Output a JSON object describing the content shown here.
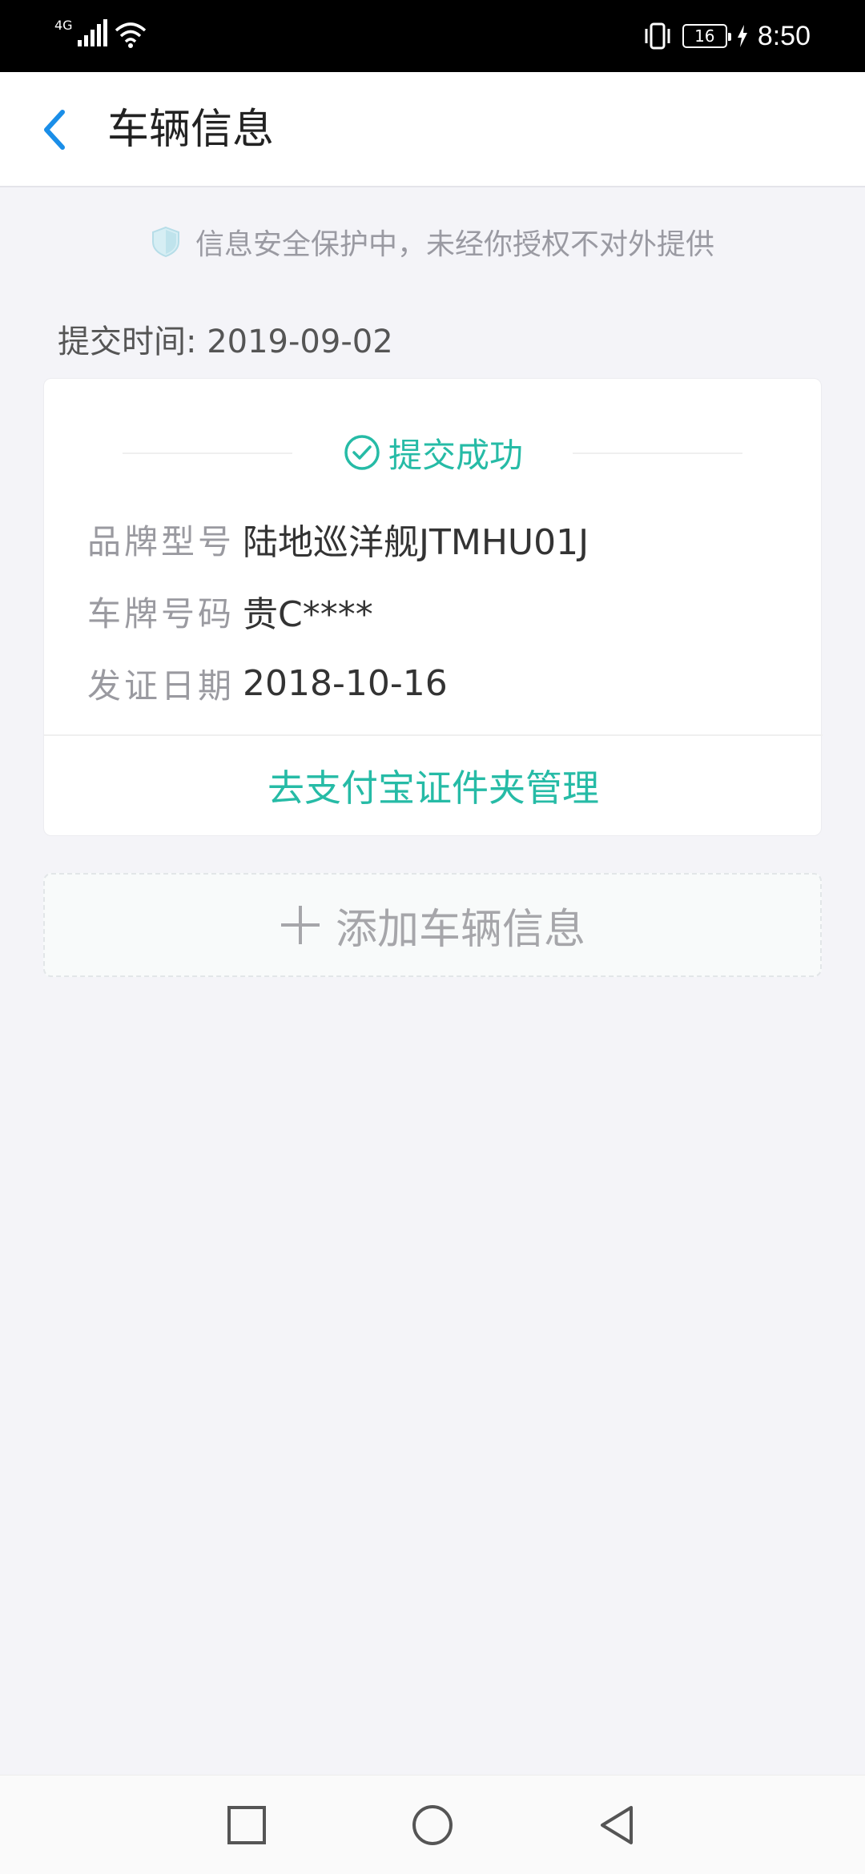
{
  "status_bar": {
    "network": "4G",
    "battery": "16",
    "time": "8:50"
  },
  "header": {
    "title": "车辆信息"
  },
  "security_notice": "信息安全保护中，未经你授权不对外提供",
  "submit_time": "提交时间: 2019-09-02",
  "card": {
    "status": "提交成功",
    "rows": [
      {
        "label": "品牌型号",
        "value": "陆地巡洋舰JTMHU01J"
      },
      {
        "label": "车牌号码",
        "value": "贵C****"
      },
      {
        "label": "发证日期",
        "value": "2018-10-16"
      }
    ],
    "manage_link": "去支付宝证件夹管理"
  },
  "add_vehicle": "添加车辆信息",
  "colors": {
    "accent": "#26bba6",
    "back_icon": "#1a8ee8"
  },
  "icons": [
    "back-icon",
    "shield-icon",
    "check-circle-icon",
    "plus-icon",
    "square-icon",
    "circle-icon",
    "triangle-back-icon"
  ]
}
